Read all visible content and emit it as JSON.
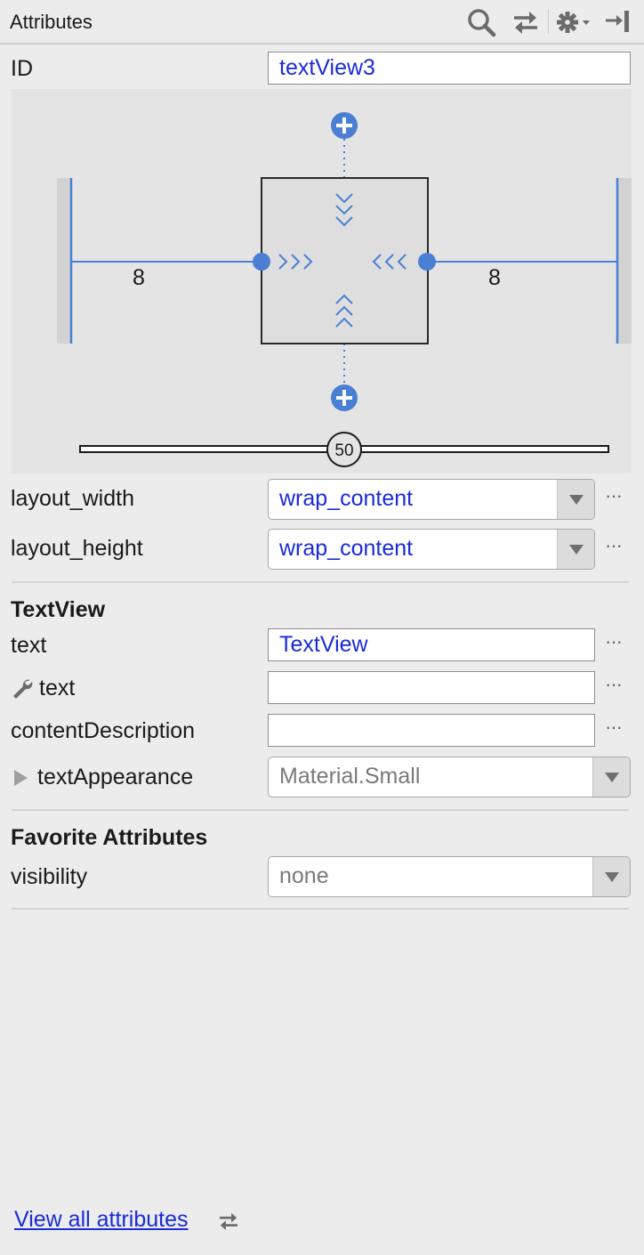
{
  "header": {
    "title": "Attributes",
    "icons": [
      "search-icon",
      "swap-icon",
      "gear-icon",
      "collapse-icon"
    ]
  },
  "id_row": {
    "label": "ID",
    "value": "textView3"
  },
  "constraint_widget": {
    "left_margin": "8",
    "right_margin": "8",
    "bias": "50",
    "accent_color": "#4a7fd4"
  },
  "layout": {
    "width_label": "layout_width",
    "width_value": "wrap_content",
    "height_label": "layout_height",
    "height_value": "wrap_content"
  },
  "textview": {
    "section_title": "TextView",
    "text_label": "text",
    "text_value": "TextView",
    "tools_text_label": "text",
    "tools_text_value": "",
    "content_desc_label": "contentDescription",
    "content_desc_value": "",
    "text_appearance_label": "textAppearance",
    "text_appearance_value": "Material.Small"
  },
  "favorites": {
    "section_title": "Favorite Attributes",
    "visibility_label": "visibility",
    "visibility_value": "none"
  },
  "ellipsis": "···",
  "footer": {
    "link": "View all attributes"
  }
}
